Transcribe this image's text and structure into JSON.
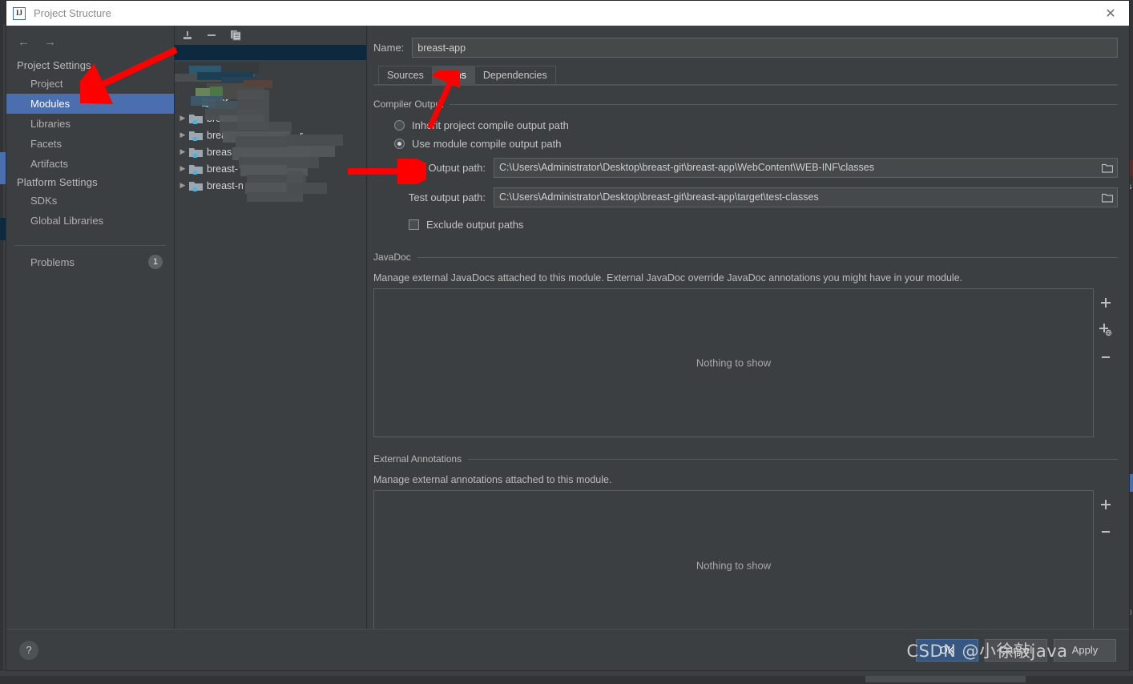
{
  "window": {
    "title": "Project Structure",
    "app_icon": "intellij-idea-icon",
    "close_label": "✕"
  },
  "sidebar": {
    "nav_back_icon": "←",
    "nav_forward_icon": "→",
    "groups": [
      {
        "title": "Project Settings",
        "items": [
          {
            "label": "Project",
            "selected": false
          },
          {
            "label": "Modules",
            "selected": true
          },
          {
            "label": "Libraries",
            "selected": false
          },
          {
            "label": "Facets",
            "selected": false
          },
          {
            "label": "Artifacts",
            "selected": false
          }
        ]
      },
      {
        "title": "Platform Settings",
        "items": [
          {
            "label": "SDKs",
            "selected": false
          },
          {
            "label": "Global Libraries",
            "selected": false
          }
        ]
      }
    ],
    "problems": {
      "label": "Problems",
      "count": "1"
    }
  },
  "tree": {
    "toolbar": [
      {
        "icon": "add-module-icon",
        "glyph": "↥"
      },
      {
        "icon": "remove-module-icon",
        "glyph": "−"
      },
      {
        "icon": "copy-module-icon",
        "glyph": "❐"
      }
    ],
    "rows": [
      {
        "label": "",
        "twisty": false,
        "selected": true,
        "censored": true
      },
      {
        "label": "",
        "twisty": false,
        "selected": false,
        "censored": true
      },
      {
        "label": "",
        "twisty": false,
        "selected": false,
        "censored": true
      },
      {
        "label": "br",
        "twisty": false,
        "selected": false,
        "censored": true
      },
      {
        "label": "bre",
        "twisty": true,
        "selected": false,
        "censored": true
      },
      {
        "label": "brea",
        "twisty": true,
        "selected": false,
        "censored": true,
        "suffix": "r"
      },
      {
        "label": "breas",
        "twisty": true,
        "selected": false,
        "censored": true,
        "suffix": "r"
      },
      {
        "label": "breast-",
        "twisty": true,
        "selected": false,
        "censored": true
      },
      {
        "label": "breast-n",
        "twisty": true,
        "selected": false,
        "censored": true
      }
    ]
  },
  "main": {
    "name_label": "Name:",
    "name_value": "breast-app",
    "tabs": [
      {
        "label": "Sources",
        "active": false
      },
      {
        "label": "Paths",
        "active": true
      },
      {
        "label": "Dependencies",
        "active": false
      }
    ],
    "compiler_output": {
      "title": "Compiler Output",
      "inherit_label": "Inherit project compile output path",
      "inherit_checked": false,
      "use_module_label": "Use module compile output path",
      "use_module_checked": true,
      "output_path_label": "Output path:",
      "output_path_value": "C:\\Users\\Administrator\\Desktop\\breast-git\\breast-app\\WebContent\\WEB-INF\\classes",
      "test_output_path_label": "Test output path:",
      "test_output_path_value": "C:\\Users\\Administrator\\Desktop\\breast-git\\breast-app\\target\\test-classes",
      "exclude_label": "Exclude output paths",
      "exclude_checked": false,
      "browse_icon": "folder-browse-icon"
    },
    "javadoc": {
      "title": "JavaDoc",
      "description": "Manage external JavaDocs attached to this module. External JavaDoc override JavaDoc annotations you might have in your module.",
      "empty_text": "Nothing to show",
      "actions": [
        {
          "name": "add-javadoc-path-button",
          "glyph": "+"
        },
        {
          "name": "add-javadoc-url-button",
          "glyph": "+"
        },
        {
          "name": "remove-javadoc-button",
          "glyph": "−"
        }
      ]
    },
    "annotations": {
      "title": "External Annotations",
      "description": "Manage external annotations attached to this module.",
      "empty_text": "Nothing to show",
      "actions": [
        {
          "name": "add-annotation-button",
          "glyph": "+"
        },
        {
          "name": "remove-annotation-button",
          "glyph": "−"
        }
      ]
    }
  },
  "footer": {
    "help_label": "?",
    "ok_label": "OK",
    "cancel_label": "Cancel",
    "apply_label": "Apply"
  },
  "watermark": {
    "text": "CSDN @小徐敲java"
  },
  "colors": {
    "accent_selection": "#4b6eaf",
    "primary_button": "#365880",
    "window_bg": "#3c3f41",
    "annotation_red": "#fe0000",
    "tree_selection": "#0d293e"
  }
}
